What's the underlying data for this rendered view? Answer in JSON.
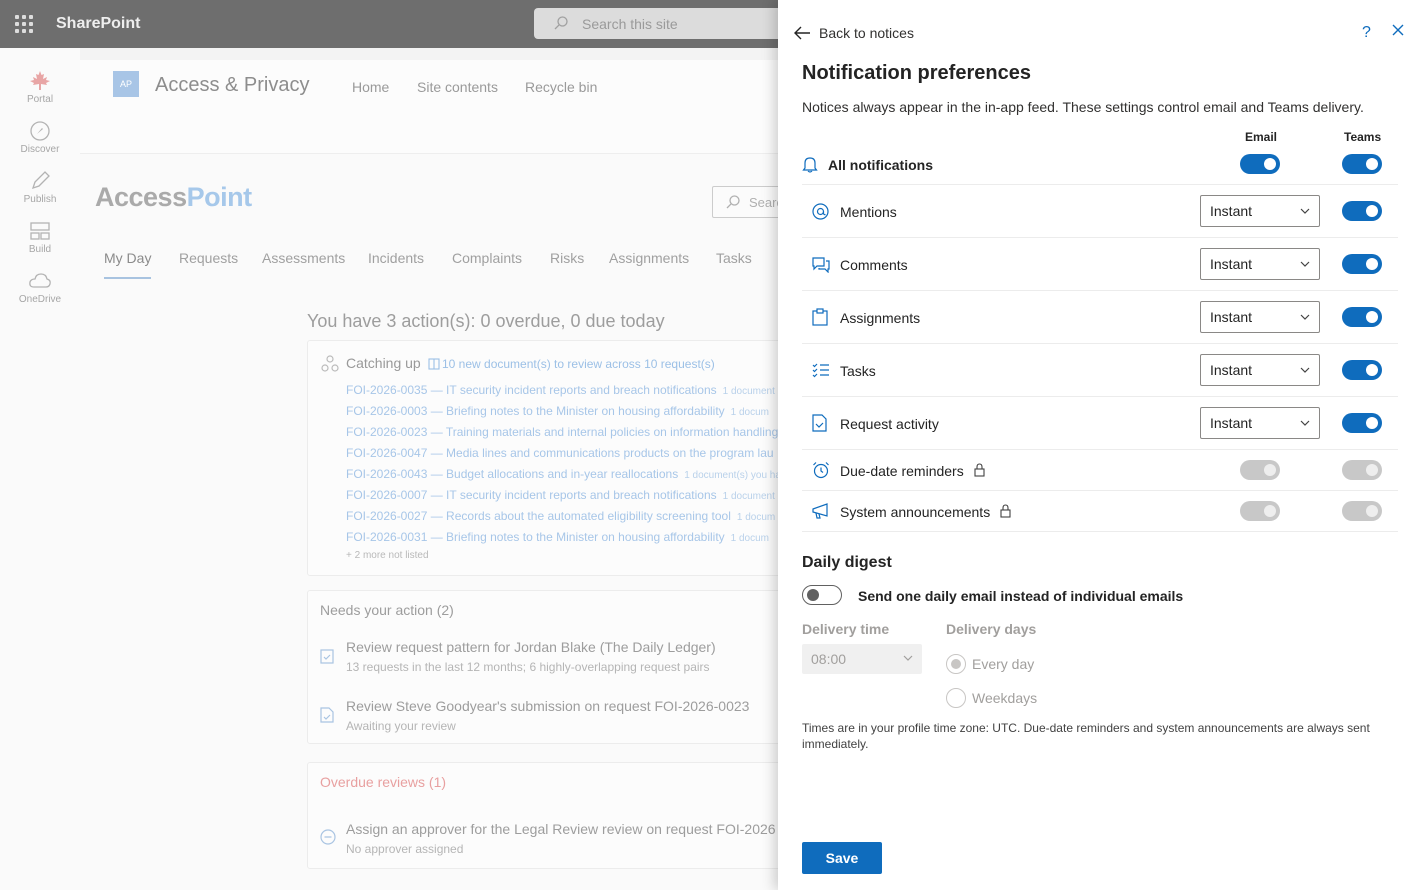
{
  "suitebar": {
    "brand": "SharePoint",
    "search_placeholder": "Search this site"
  },
  "rail": [
    {
      "label": "Portal",
      "icon": "maple-leaf-icon"
    },
    {
      "label": "Discover",
      "icon": "compass-icon"
    },
    {
      "label": "Publish",
      "icon": "pen-icon"
    },
    {
      "label": "Build",
      "icon": "layout-icon"
    },
    {
      "label": "OneDrive",
      "icon": "cloud-icon"
    }
  ],
  "site": {
    "logo": "AP",
    "title": "Access & Privacy",
    "nav": [
      "Home",
      "Site contents",
      "Recycle bin"
    ],
    "brand_a": "Access",
    "brand_b": "Point",
    "search_placeholder": "Search",
    "tabs": [
      "My Day",
      "Requests",
      "Assessments",
      "Incidents",
      "Complaints",
      "Risks",
      "Assignments",
      "Tasks"
    ]
  },
  "myday": {
    "summary": "You have 3 action(s): 0 overdue, 0 due today",
    "catching_up": {
      "title": "Catching up",
      "link": "10 new document(s) to review across 10 request(s)",
      "docs": [
        {
          "text": "FOI-2026-0035 — IT security incident reports and breach notifications",
          "count": "1 document"
        },
        {
          "text": "FOI-2026-0003 — Briefing notes to the Minister on housing affordability",
          "count": "1 docum"
        },
        {
          "text": "FOI-2026-0023 — Training materials and internal policies on information handling",
          "count": ""
        },
        {
          "text": "FOI-2026-0047 — Media lines and communications products on the program lau",
          "count": ""
        },
        {
          "text": "FOI-2026-0043 — Budget allocations and in-year reallocations",
          "count": "1 document(s) you ha"
        },
        {
          "text": "FOI-2026-0007 — IT security incident reports and breach notifications",
          "count": "1 document"
        },
        {
          "text": "FOI-2026-0027 — Records about the automated eligibility screening tool",
          "count": "1 docum"
        },
        {
          "text": "FOI-2026-0031 — Briefing notes to the Minister on housing affordability",
          "count": "1 docum"
        }
      ],
      "more": "+ 2 more not listed"
    },
    "needs_action": {
      "title": "Needs your action (2)",
      "items": [
        {
          "title": "Review request pattern for Jordan Blake (The Daily Ledger)",
          "sub": "13 requests in the last 12 months; 6 highly-overlapping request pairs"
        },
        {
          "title": "Review Steve Goodyear's submission on request FOI-2026-0023",
          "sub": "Awaiting your review"
        }
      ]
    },
    "overdue": {
      "title": "Overdue reviews (1)",
      "items": [
        {
          "title": "Assign an approver for the Legal Review review on request FOI-2026",
          "sub": "No approver assigned"
        }
      ]
    }
  },
  "panel": {
    "back": "Back to notices",
    "help": "?",
    "title": "Notification preferences",
    "subtitle": "Notices always appear in the in-app feed. These settings control email and Teams delivery.",
    "col_email": "Email",
    "col_teams": "Teams",
    "all_label": "All notifications",
    "rows": [
      {
        "label": "Mentions",
        "email": "Instant"
      },
      {
        "label": "Comments",
        "email": "Instant"
      },
      {
        "label": "Assignments",
        "email": "Instant"
      },
      {
        "label": "Tasks",
        "email": "Instant"
      },
      {
        "label": "Request activity",
        "email": "Instant"
      }
    ],
    "locked_rows": [
      {
        "label": "Due-date reminders"
      },
      {
        "label": "System announcements"
      }
    ],
    "digest": {
      "title": "Daily digest",
      "toggle_label": "Send one daily email instead of individual emails",
      "time_label": "Delivery time",
      "time_value": "08:00",
      "days_label": "Delivery days",
      "opt_every": "Every day",
      "opt_weekdays": "Weekdays",
      "note": "Times are in your profile time zone: UTC. Due-date reminders and system announcements are always sent immediately."
    },
    "save": "Save"
  }
}
